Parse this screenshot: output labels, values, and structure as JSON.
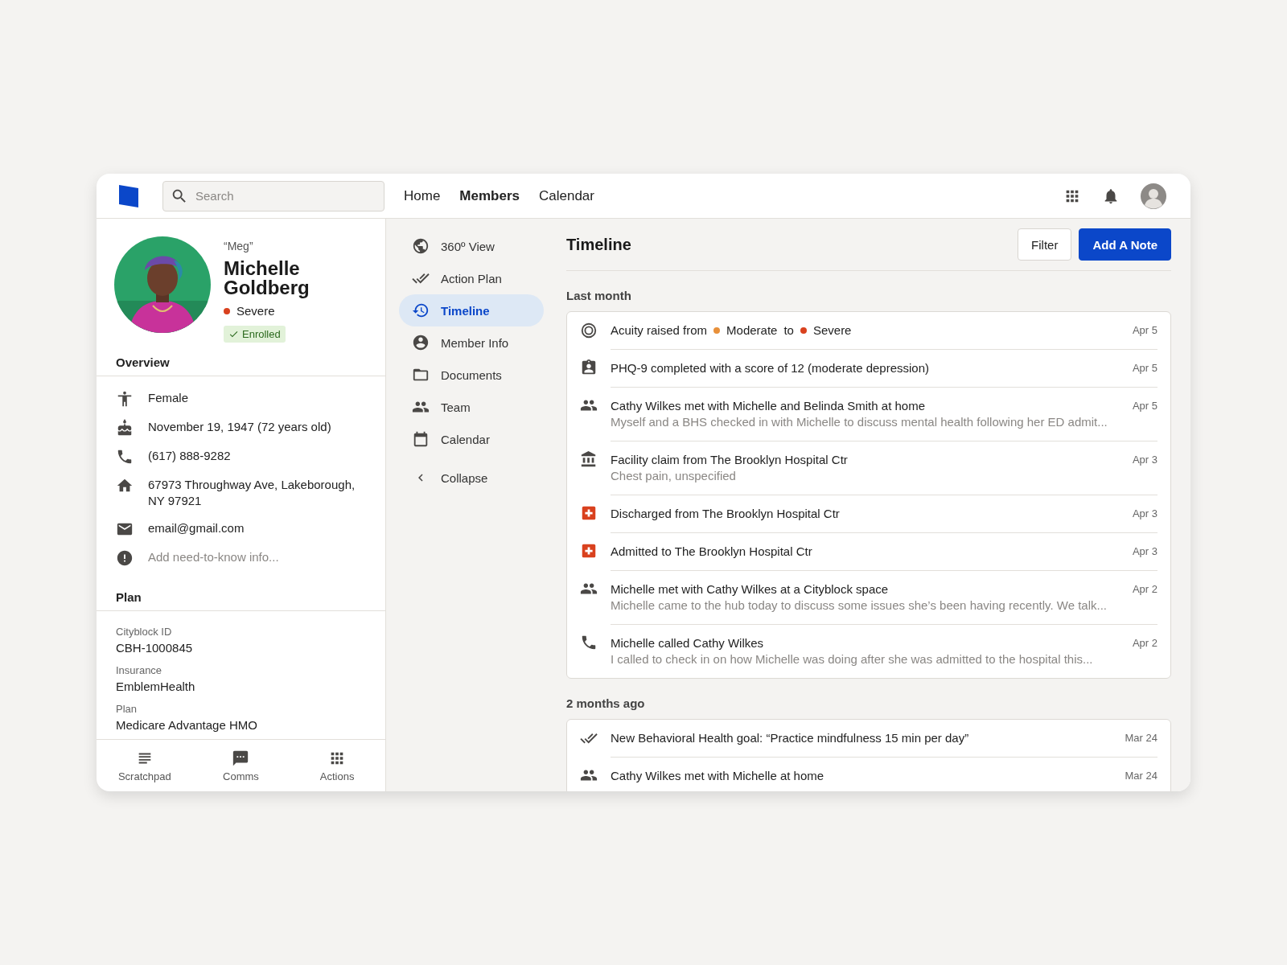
{
  "header": {
    "search": {
      "placeholder": "Search"
    },
    "nav": [
      {
        "label": "Home",
        "selected": false
      },
      {
        "label": "Members",
        "selected": true
      },
      {
        "label": "Calendar",
        "selected": false
      }
    ]
  },
  "member": {
    "nickname": "“Meg”",
    "name": "Michelle Goldberg",
    "acuity": {
      "label": "Severe",
      "color": "#d9411e"
    },
    "status": "Enrolled"
  },
  "overview": {
    "title": "Overview",
    "rows": [
      {
        "kind": "gender",
        "text": "Female"
      },
      {
        "kind": "birthday",
        "text": "November 19, 1947 (72 years old)"
      },
      {
        "kind": "phone",
        "text": "(617) 888-9282"
      },
      {
        "kind": "address",
        "text": "67973 Throughway Ave, Lakeborough, NY 97921"
      },
      {
        "kind": "email",
        "text": "email@gmail.com"
      },
      {
        "kind": "prompt",
        "text": "Add need-to-know info..."
      }
    ]
  },
  "plan": {
    "title": "Plan",
    "fields": [
      {
        "label": "Cityblock ID",
        "value": "CBH-1000845"
      },
      {
        "label": "Insurance",
        "value": "EmblemHealth"
      },
      {
        "label": "Plan",
        "value": "Medicare Advantage HMO"
      }
    ]
  },
  "bottom_tabs": [
    {
      "kind": "scratchpad",
      "label": "Scratchpad"
    },
    {
      "kind": "comms",
      "label": "Comms"
    },
    {
      "kind": "actions",
      "label": "Actions"
    }
  ],
  "side_nav": {
    "items": [
      {
        "kind": "globe",
        "label": "360º View",
        "selected": false
      },
      {
        "kind": "checks",
        "label": "Action Plan",
        "selected": false
      },
      {
        "kind": "history",
        "label": "Timeline",
        "selected": true
      },
      {
        "kind": "account",
        "label": "Member Info",
        "selected": false
      },
      {
        "kind": "folder",
        "label": "Documents",
        "selected": false
      },
      {
        "kind": "people",
        "label": "Team",
        "selected": false
      },
      {
        "kind": "calendar",
        "label": "Calendar",
        "selected": false
      }
    ],
    "collapse": "Collapse"
  },
  "timeline": {
    "title": "Timeline",
    "buttons": [
      {
        "kind": "secondary",
        "label": "Filter"
      },
      {
        "kind": "primary",
        "label": "Add A Note"
      }
    ],
    "groups": [
      {
        "label": "Last month",
        "events": [
          {
            "kind": "acuity",
            "parts": [
              {
                "text": "Acuity raised from"
              },
              {
                "text": "Moderate",
                "color": "#e8903a"
              },
              {
                "text": "to"
              },
              {
                "text": "Severe",
                "color": "#d9411e"
              }
            ],
            "date": "Apr 5"
          },
          {
            "kind": "assessment",
            "title": "PHQ-9 completed with a score of 12 (moderate depression)",
            "date": "Apr 5"
          },
          {
            "kind": "meeting",
            "title": "Cathy Wilkes met with Michelle and Belinda Smith at home",
            "detail": "Myself and a BHS checked in with Michelle to discuss mental health following her ED admit...",
            "date": "Apr 5"
          },
          {
            "kind": "claim",
            "title": "Facility claim from The Brooklyn Hospital Ctr",
            "detail": "Chest pain, unspecified",
            "date": "Apr 3"
          },
          {
            "kind": "hospital",
            "title": "Discharged from The Brooklyn Hospital Ctr",
            "date": "Apr 3"
          },
          {
            "kind": "hospital",
            "title": "Admitted to The Brooklyn Hospital Ctr",
            "date": "Apr 3"
          },
          {
            "kind": "meeting",
            "title": "Michelle met with Cathy Wilkes at a Cityblock space",
            "detail": "Michelle came to the hub today to discuss some issues she’s been having recently. We talk...",
            "date": "Apr 2"
          },
          {
            "kind": "call",
            "title": "Michelle called Cathy Wilkes",
            "detail": "I called to check in on how Michelle was doing after she was admitted to the hospital this...",
            "date": "Apr 2"
          }
        ]
      },
      {
        "label": "2 months ago",
        "events": [
          {
            "kind": "goal",
            "title": "New Behavioral Health goal: “Practice mindfulness 15 min per day”",
            "date": "Mar 24"
          },
          {
            "kind": "meeting",
            "title": "Cathy Wilkes met with Michelle at home",
            "date": "Mar 24"
          }
        ]
      }
    ]
  }
}
